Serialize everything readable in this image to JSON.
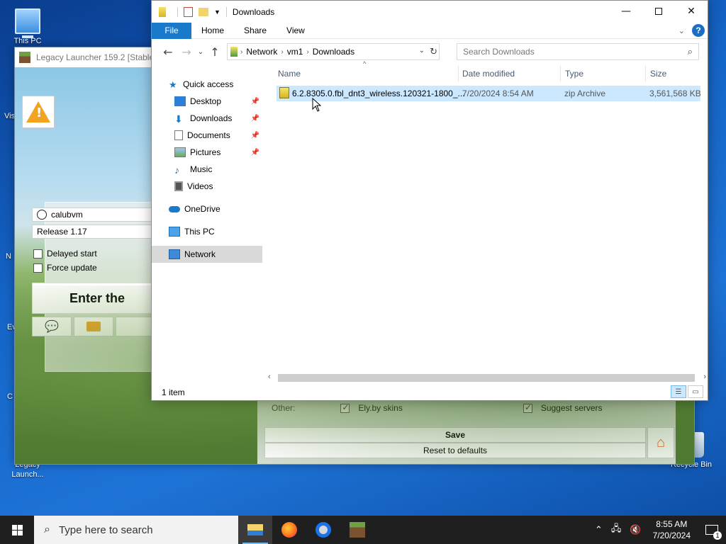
{
  "desktop": {
    "icons": [
      {
        "label": "This PC"
      },
      {
        "label": "Legacy Launch..."
      },
      {
        "label": "Recycle Bin"
      }
    ],
    "edge_fragments": [
      "Vis",
      "N",
      "Ev",
      "C"
    ]
  },
  "launcher": {
    "title": "Legacy Launcher 159.2 [Stable]",
    "username": "calubvm",
    "version": "Release 1.17",
    "delayed_start_label": "Delayed start",
    "force_update_label": "Force update",
    "enter_button": "Enter the",
    "settings": {
      "other_label": "Other:",
      "ely_label": "Ely.by skins",
      "suggest_label": "Suggest servers",
      "save_label": "Save",
      "reset_label": "Reset to defaults"
    }
  },
  "explorer": {
    "title": "Downloads",
    "ribbon_tabs": [
      "File",
      "Home",
      "Share",
      "View"
    ],
    "breadcrumb": [
      "Network",
      "vm1",
      "Downloads"
    ],
    "search_placeholder": "Search Downloads",
    "nav": {
      "quick_access": "Quick access",
      "desktop": "Desktop",
      "downloads": "Downloads",
      "documents": "Documents",
      "pictures": "Pictures",
      "music": "Music",
      "videos": "Videos",
      "onedrive": "OneDrive",
      "this_pc": "This PC",
      "network": "Network"
    },
    "columns": {
      "name": "Name",
      "date": "Date modified",
      "type": "Type",
      "size": "Size"
    },
    "files": [
      {
        "name": "6.2.8305.0.fbl_dnt3_wireless.120321-1800_...",
        "date": "7/20/2024 8:54 AM",
        "type": "zip Archive",
        "size": "3,561,568 KB"
      }
    ],
    "status": "1 item"
  },
  "taskbar": {
    "search_placeholder": "Type here to search",
    "time": "8:55 AM",
    "date": "7/20/2024",
    "notification_count": "1"
  },
  "colors": {
    "accent": "#1979ca",
    "selection": "#cce8ff"
  }
}
